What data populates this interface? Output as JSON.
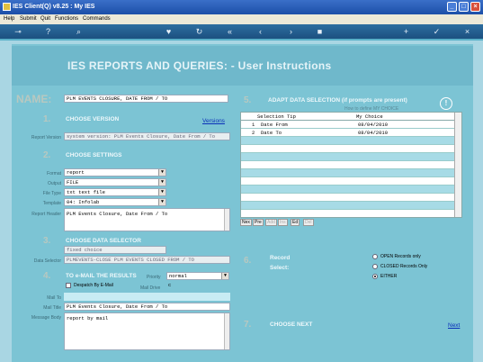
{
  "window": {
    "title": "IES Client(Q) v8.25 : My IES"
  },
  "menu": [
    "Help",
    "Submit",
    "Quit",
    "Functions",
    "Commands"
  ],
  "toolbar_icons": [
    "key-icon",
    "help-icon",
    "search-icon",
    "heart-icon",
    "refresh-icon",
    "rewind-icon",
    "back-icon",
    "forward-icon",
    "stop-icon",
    "add-icon",
    "check-icon",
    "close-icon"
  ],
  "banner": {
    "heading": "IES REPORTS AND QUERIES:  -   User Instructions"
  },
  "name": {
    "label": "NAME:",
    "value": "PLM EVENTS CLOSURE, DATE FROM / TO"
  },
  "version": {
    "num": "1.",
    "title": "CHOOSE VERSION",
    "link": "Versions",
    "field_label": "Report Version",
    "value": "system version: PLM Events Closure, Date From / To"
  },
  "settings": {
    "num": "2.",
    "title": "CHOOSE SETTINGS",
    "labels": {
      "format": "Format",
      "output": "Output",
      "file_type": "File Type",
      "template": "Template",
      "report_header": "Report Header"
    },
    "format": "report",
    "output": "FILE",
    "file_type": "txt text file",
    "template": "04: Infolab",
    "report_header": "PLM Events Closure, Date From / To"
  },
  "selector": {
    "num": "3.",
    "title": "CHOOSE DATA SELECTOR",
    "field_label": "Data Selector",
    "choice": "fixed choice",
    "value": "PLMEVENTS-CLOSE PLM EVENTS CLOSED FROM / TO"
  },
  "email": {
    "num": "4.",
    "title": "TO e-MAIL THE RESULTS",
    "despatch": "Despatch By E-Mail",
    "priority_label": "Priority",
    "priority": "normal",
    "mail_drive_label": "Mail Drive",
    "mail_drive": "c",
    "mail_to_label": "Mail To",
    "mail_title_label": "Mail Title",
    "mail_title": "PLM Events Closure, Date From / To",
    "body_label": "Message Body",
    "body": "report by mail"
  },
  "adapt": {
    "num": "5.",
    "title": "ADAPT DATA SELECTION (if prompts are present)",
    "hint": "How to define MY CHOICE",
    "col_tip": "Selection Tip",
    "col_choice": "My Choice",
    "rows": [
      {
        "n": "1",
        "tip": "Date From",
        "choice": "08/04/2010"
      },
      {
        "n": "2",
        "tip": "Date To",
        "choice": "08/04/2010"
      }
    ],
    "buttons": [
      "Nex",
      "Pre",
      "Add",
      "Ins",
      "Ed",
      "Del"
    ]
  },
  "record": {
    "num": "6.",
    "title": "Record",
    "sub": "Select:",
    "options": [
      "OPEN Records only",
      "CLOSED Records Only",
      "EITHER"
    ],
    "selected": "EITHER"
  },
  "next": {
    "num": "7.",
    "title": "CHOOSE NEXT",
    "link": "Next"
  },
  "colors": {
    "panel": "#7cc4d4",
    "banner": "#6fb8cb",
    "title_bar": "#1c4fa8"
  }
}
